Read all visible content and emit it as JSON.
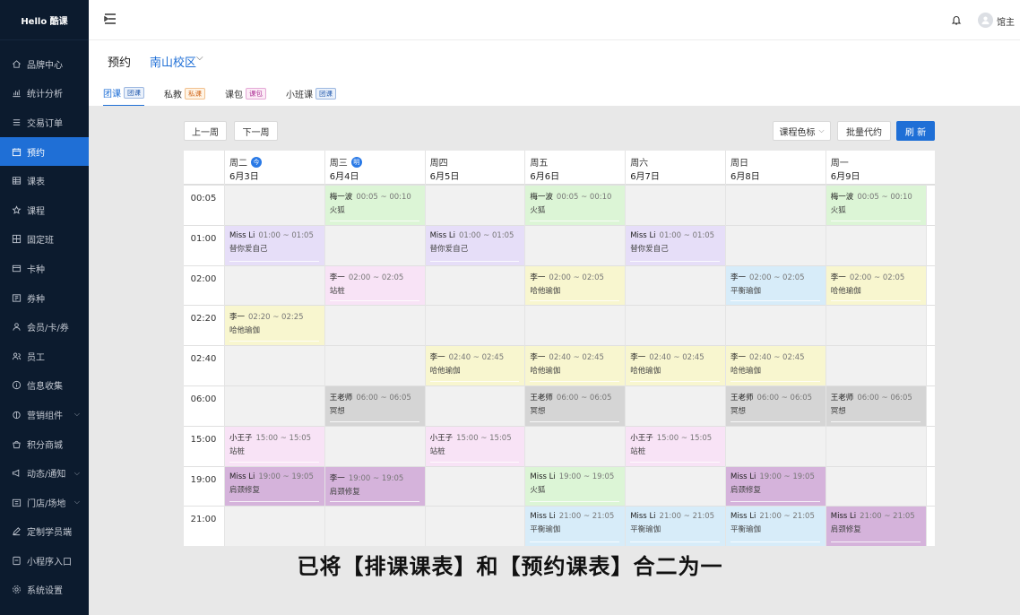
{
  "brand": "Hello 酷课",
  "sidebar": {
    "items": [
      {
        "label": "品牌中心",
        "icon": "home-icon"
      },
      {
        "label": "统计分析",
        "icon": "chart-icon"
      },
      {
        "label": "交易订单",
        "icon": "list-icon"
      },
      {
        "label": "预约",
        "icon": "calendar-icon",
        "active": true
      },
      {
        "label": "课表",
        "icon": "table-icon"
      },
      {
        "label": "课程",
        "icon": "star-icon"
      },
      {
        "label": "固定班",
        "icon": "grid-icon"
      },
      {
        "label": "卡种",
        "icon": "card-icon"
      },
      {
        "label": "券种",
        "icon": "coupon-icon"
      },
      {
        "label": "会员/卡/券",
        "icon": "user-icon"
      },
      {
        "label": "员工",
        "icon": "staff-icon"
      },
      {
        "label": "信息收集",
        "icon": "info-icon"
      },
      {
        "label": "营销组件",
        "icon": "gift-icon",
        "expandable": true
      },
      {
        "label": "积分商城",
        "icon": "shop-icon"
      },
      {
        "label": "动态/通知",
        "icon": "megaphone-icon",
        "expandable": true
      },
      {
        "label": "门店/场地",
        "icon": "store-icon",
        "expandable": true
      },
      {
        "label": "定制学员端",
        "icon": "edit-icon"
      },
      {
        "label": "小程序入口",
        "icon": "miniapp-icon"
      },
      {
        "label": "系统设置",
        "icon": "settings-icon"
      }
    ]
  },
  "header": {
    "user_name": "馆主"
  },
  "subheader": {
    "title": "预约",
    "campus": "南山校区",
    "tabs": [
      {
        "label": "团课",
        "tag": "团课",
        "tag_style": "blue",
        "active": true
      },
      {
        "label": "私教",
        "tag": "私课",
        "tag_style": "orange"
      },
      {
        "label": "课包",
        "tag": "课包",
        "tag_style": "pink"
      },
      {
        "label": "小班课",
        "tag": "团课",
        "tag_style": "blue"
      }
    ]
  },
  "toolbar": {
    "prev_week": "上一周",
    "next_week": "下一周",
    "color_label": "课程色标",
    "batch_book": "批量代约",
    "refresh": "刷 新"
  },
  "calendar": {
    "days": [
      {
        "name": "周二",
        "date": "6月3日",
        "badge": "今"
      },
      {
        "name": "周三",
        "date": "6月4日",
        "badge": "明"
      },
      {
        "name": "周四",
        "date": "6月5日"
      },
      {
        "name": "周五",
        "date": "6月6日"
      },
      {
        "name": "周六",
        "date": "6月7日"
      },
      {
        "name": "周日",
        "date": "6月8日"
      },
      {
        "name": "周一",
        "date": "6月9日"
      }
    ],
    "times": [
      "00:05",
      "01:00",
      "02:00",
      "02:20",
      "02:40",
      "06:00",
      "15:00",
      "19:00",
      "21:00"
    ],
    "events": [
      {
        "day": 1,
        "slot": 0,
        "teacher": "梅一波",
        "time": "00:05 ~ 00:10",
        "course": "火狐",
        "color": "green"
      },
      {
        "day": 3,
        "slot": 0,
        "teacher": "梅一波",
        "time": "00:05 ~ 00:10",
        "course": "火狐",
        "color": "green"
      },
      {
        "day": 6,
        "slot": 0,
        "teacher": "梅一波",
        "time": "00:05 ~ 00:10",
        "course": "火狐",
        "color": "green"
      },
      {
        "day": 0,
        "slot": 1,
        "teacher": "Miss Li",
        "time": "01:00 ~ 01:05",
        "course": "替你爱自己",
        "color": "purple"
      },
      {
        "day": 2,
        "slot": 1,
        "teacher": "Miss Li",
        "time": "01:00 ~ 01:05",
        "course": "替你爱自己",
        "color": "purple"
      },
      {
        "day": 4,
        "slot": 1,
        "teacher": "Miss Li",
        "time": "01:00 ~ 01:05",
        "course": "替你爱自己",
        "color": "purple"
      },
      {
        "day": 1,
        "slot": 2,
        "teacher": "李一",
        "time": "02:00 ~ 02:05",
        "course": "站桩",
        "color": "pink"
      },
      {
        "day": 3,
        "slot": 2,
        "teacher": "李一",
        "time": "02:00 ~ 02:05",
        "course": "哈他瑜伽",
        "color": "yellow"
      },
      {
        "day": 5,
        "slot": 2,
        "teacher": "李一",
        "time": "02:00 ~ 02:05",
        "course": "平衡瑜伽",
        "color": "blue"
      },
      {
        "day": 6,
        "slot": 2,
        "teacher": "李一",
        "time": "02:00 ~ 02:05",
        "course": "哈他瑜伽",
        "color": "yellow"
      },
      {
        "day": 0,
        "slot": 3,
        "teacher": "李一",
        "time": "02:20 ~ 02:25",
        "course": "哈他瑜伽",
        "color": "yellow"
      },
      {
        "day": 2,
        "slot": 4,
        "teacher": "李一",
        "time": "02:40 ~ 02:45",
        "course": "哈他瑜伽",
        "color": "yellow"
      },
      {
        "day": 3,
        "slot": 4,
        "teacher": "李一",
        "time": "02:40 ~ 02:45",
        "course": "哈他瑜伽",
        "color": "yellow"
      },
      {
        "day": 4,
        "slot": 4,
        "teacher": "李一",
        "time": "02:40 ~ 02:45",
        "course": "哈他瑜伽",
        "color": "yellow"
      },
      {
        "day": 5,
        "slot": 4,
        "teacher": "李一",
        "time": "02:40 ~ 02:45",
        "course": "哈他瑜伽",
        "color": "yellow"
      },
      {
        "day": 1,
        "slot": 5,
        "teacher": "王老师",
        "time": "06:00 ~ 06:05",
        "course": "冥想",
        "color": "gray"
      },
      {
        "day": 3,
        "slot": 5,
        "teacher": "王老师",
        "time": "06:00 ~ 06:05",
        "course": "冥想",
        "color": "gray"
      },
      {
        "day": 5,
        "slot": 5,
        "teacher": "王老师",
        "time": "06:00 ~ 06:05",
        "course": "冥想",
        "color": "gray"
      },
      {
        "day": 6,
        "slot": 5,
        "teacher": "王老师",
        "time": "06:00 ~ 06:05",
        "course": "冥想",
        "color": "gray"
      },
      {
        "day": 0,
        "slot": 6,
        "teacher": "小王子",
        "time": "15:00 ~ 15:05",
        "course": "站桩",
        "color": "pink"
      },
      {
        "day": 2,
        "slot": 6,
        "teacher": "小王子",
        "time": "15:00 ~ 15:05",
        "course": "站桩",
        "color": "pink"
      },
      {
        "day": 4,
        "slot": 6,
        "teacher": "小王子",
        "time": "15:00 ~ 15:05",
        "course": "站桩",
        "color": "pink"
      },
      {
        "day": 0,
        "slot": 7,
        "teacher": "Miss Li",
        "time": "19:00 ~ 19:05",
        "course": "肩颈修复",
        "color": "mauve"
      },
      {
        "day": 1,
        "slot": 7,
        "teacher": "李一",
        "time": "19:00 ~ 19:05",
        "course": "肩颈修复",
        "color": "mauve"
      },
      {
        "day": 3,
        "slot": 7,
        "teacher": "Miss Li",
        "time": "19:00 ~ 19:05",
        "course": "火狐",
        "color": "green"
      },
      {
        "day": 5,
        "slot": 7,
        "teacher": "Miss Li",
        "time": "19:00 ~ 19:05",
        "course": "肩颈修复",
        "color": "mauve"
      },
      {
        "day": 3,
        "slot": 8,
        "teacher": "Miss Li",
        "time": "21:00 ~ 21:05",
        "course": "平衡瑜伽",
        "color": "blue"
      },
      {
        "day": 4,
        "slot": 8,
        "teacher": "Miss Li",
        "time": "21:00 ~ 21:05",
        "course": "平衡瑜伽",
        "color": "blue"
      },
      {
        "day": 5,
        "slot": 8,
        "teacher": "Miss Li",
        "time": "21:00 ~ 21:05",
        "course": "平衡瑜伽",
        "color": "blue"
      },
      {
        "day": 6,
        "slot": 8,
        "teacher": "Miss Li",
        "time": "21:00 ~ 21:05",
        "course": "肩颈修复",
        "color": "mauve"
      }
    ]
  },
  "caption": "已将【排课课表】和【预约课表】合二为一"
}
